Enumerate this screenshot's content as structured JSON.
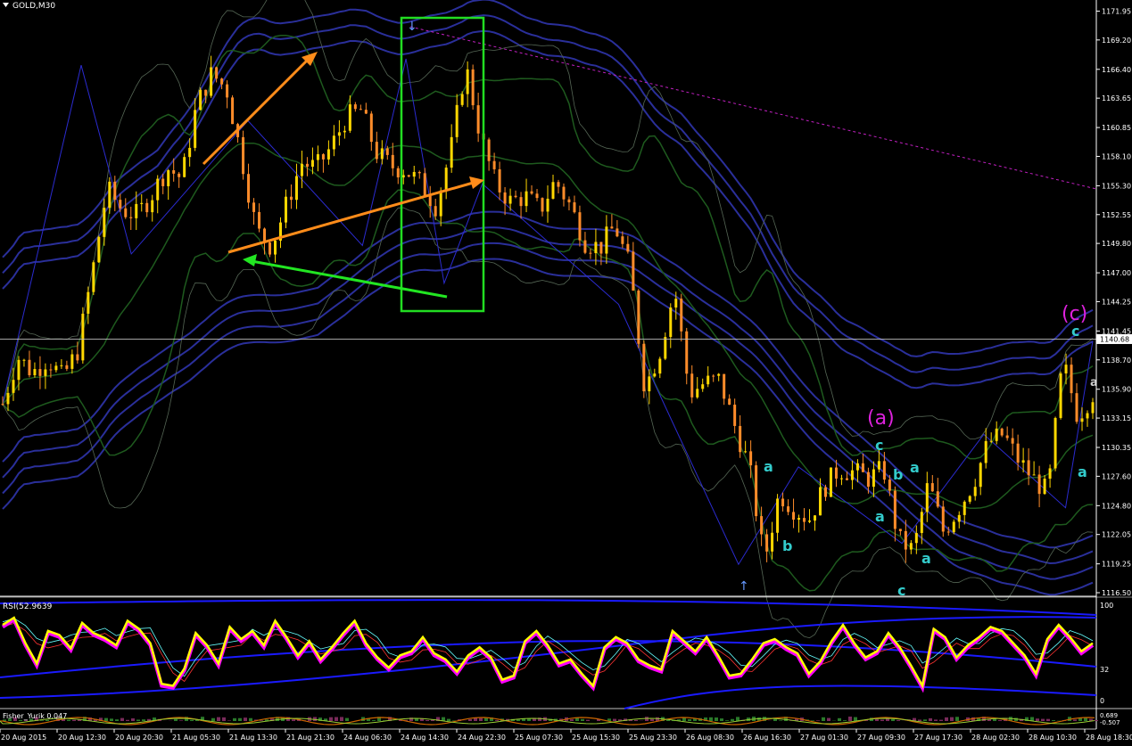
{
  "window": {
    "title": "GOLD,M30"
  },
  "colors": {
    "background": "#000000",
    "axis_text": "#ffffff",
    "bull_candle": "#ffd700",
    "bear_candle": "#ff8c2a",
    "ma_band": "#2a2f9a",
    "bollinger": "#1e5a1e",
    "zigzag": "#2b2bd0",
    "trend_orange": "#ff8c1a",
    "arrow_green": "#22e622",
    "box_green": "#22dd22",
    "dotted_line": "#c020c0",
    "wave_major": "#dd22dd",
    "wave_minor": "#33cccc",
    "rsi_yellow": "#ffff00",
    "rsi_magenta": "#ff00ff",
    "rsi_cyan": "#66ffff",
    "rsi_red": "#ff3333",
    "rsi_band": "#1a1aff",
    "current_price_line": "#bbbbbb"
  },
  "chart_data": [
    {
      "type": "candlestick",
      "symbol": "GOLD",
      "timeframe": "M30",
      "title": "GOLD,M30",
      "ylim": [
        1116.5,
        1172.5
      ],
      "y_ticks": [
        1171.95,
        1169.2,
        1166.4,
        1163.65,
        1160.85,
        1158.1,
        1155.3,
        1152.55,
        1149.8,
        1147.0,
        1144.25,
        1141.45,
        1138.7,
        1135.9,
        1133.15,
        1130.35,
        1127.6,
        1124.8,
        1122.05,
        1119.25,
        1116.5
      ],
      "current_price": 1140.68,
      "x_ticks": [
        "20 Aug 2015",
        "20 Aug 12:30",
        "20 Aug 20:30",
        "21 Aug 05:30",
        "21 Aug 13:30",
        "21 Aug 21:30",
        "24 Aug 06:30",
        "24 Aug 14:30",
        "24 Aug 22:30",
        "25 Aug 07:30",
        "25 Aug 15:30",
        "25 Aug 23:30",
        "26 Aug 08:30",
        "26 Aug 16:30",
        "27 Aug 01:30",
        "27 Aug 09:30",
        "27 Aug 17:30",
        "28 Aug 02:30",
        "28 Aug 10:30",
        "28 Aug 18:30"
      ],
      "price_path": [
        1134.5,
        1139,
        1137.5,
        1138.8,
        1137,
        1139.5,
        1147,
        1155,
        1153,
        1152.5,
        1154.5,
        1157,
        1156,
        1163,
        1166,
        1164.5,
        1158,
        1151,
        1149.5,
        1153.5,
        1157.5,
        1157,
        1159,
        1161.8,
        1162.5,
        1158.5,
        1157.2,
        1156.8,
        1155.5,
        1153.4,
        1158.6,
        1166.8,
        1160,
        1155.5,
        1153.8,
        1154.3,
        1153,
        1155.8,
        1153.4,
        1150,
        1149.4,
        1151.5,
        1147.5,
        1136,
        1139.5,
        1145.5,
        1135.5,
        1136.5,
        1136.8,
        1132.5,
        1128.5,
        1119.5,
        1126,
        1124.5,
        1123.5,
        1126.5,
        1128.3,
        1128,
        1127.4,
        1128.3,
        1121.5,
        1120.5,
        1127,
        1122.3,
        1124.5,
        1127,
        1130.8,
        1131.6,
        1129.2,
        1127.4,
        1126,
        1138.6,
        1133.3,
        1135.5
      ],
      "annotations": [
        {
          "label": "(a)",
          "style": "major"
        },
        {
          "label": "(c)",
          "style": "major"
        },
        {
          "label": "a",
          "style": "minor"
        },
        {
          "label": "b",
          "style": "minor"
        },
        {
          "label": "c",
          "style": "minor"
        },
        {
          "label": "a",
          "style": "minor"
        },
        {
          "label": "b",
          "style": "minor"
        },
        {
          "label": "a",
          "style": "minor"
        },
        {
          "label": "c",
          "style": "minor"
        },
        {
          "label": "a",
          "style": "minor"
        },
        {
          "label": "c",
          "style": "minor"
        },
        {
          "label": "a",
          "style": "minor"
        },
        {
          "label": "a",
          "style": "minor"
        }
      ]
    },
    {
      "type": "line",
      "title": "RSI(",
      "value_label": "52.9639",
      "ylim": [
        0,
        100
      ],
      "y_ticks": [
        100,
        32,
        0
      ],
      "series": [
        {
          "values": [
            78,
            85,
            60,
            40,
            72,
            68,
            55,
            80,
            70,
            65,
            58,
            82,
            74,
            60,
            20,
            18,
            35,
            70,
            58,
            40,
            76,
            64,
            72,
            58,
            82,
            66,
            48,
            62,
            44,
            56,
            70,
            82,
            60,
            46,
            36,
            48,
            52,
            66,
            50,
            44,
            32,
            48,
            56,
            46,
            24,
            28,
            62,
            72,
            58,
            40,
            44,
            30,
            18,
            56,
            66,
            60,
            44,
            38,
            34,
            72,
            62,
            52,
            66,
            48,
            28,
            30,
            44,
            60,
            64,
            56,
            50,
            30,
            42,
            62,
            78,
            60,
            46,
            52,
            70,
            56,
            38,
            18,
            74,
            66,
            46,
            58,
            66,
            76,
            72,
            60,
            48,
            30,
            64,
            78,
            66,
            52,
            60
          ]
        }
      ]
    },
    {
      "type": "bar",
      "title": "Fisher_Yurik",
      "value_label": "0.047",
      "y_ticks": [
        "0.689",
        "-0.507"
      ]
    }
  ]
}
